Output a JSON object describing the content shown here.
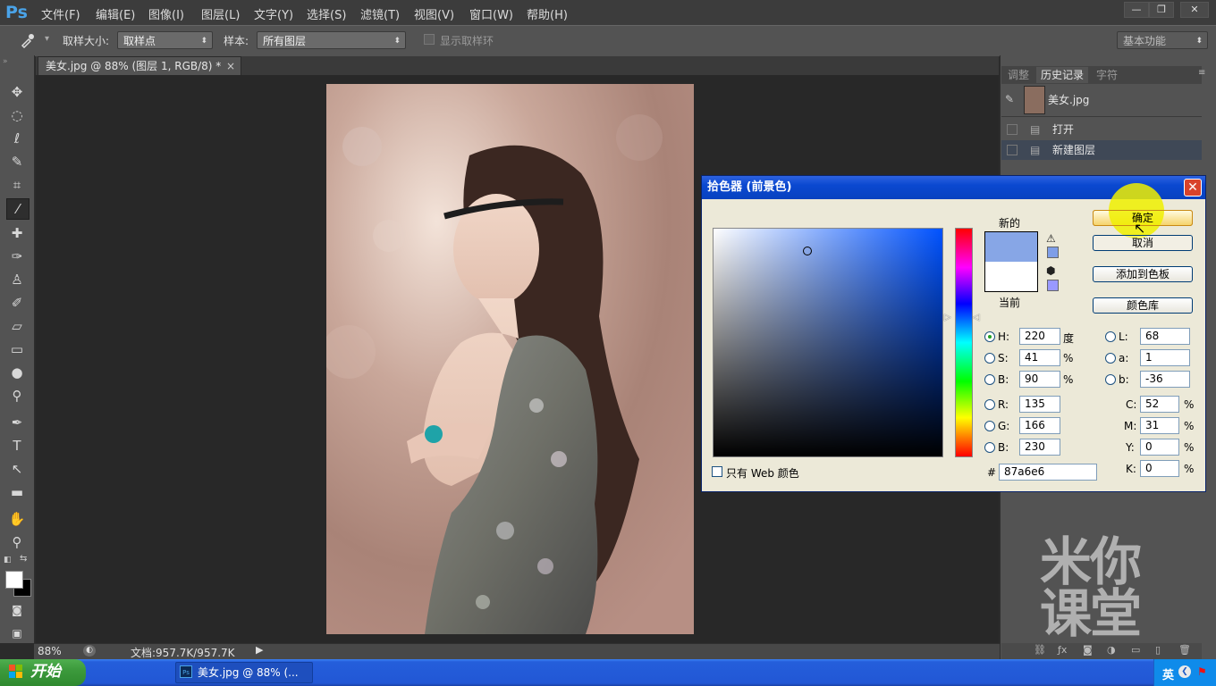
{
  "app": {
    "logo": "Ps"
  },
  "menu": [
    "文件(F)",
    "编辑(E)",
    "图像(I)",
    "图层(L)",
    "文字(Y)",
    "选择(S)",
    "滤镜(T)",
    "视图(V)",
    "窗口(W)",
    "帮助(H)"
  ],
  "window_buttons": {
    "minimize": "—",
    "restore": "❐",
    "close": "✕"
  },
  "options": {
    "sample_size_label": "取样大小:",
    "sample_size_value": "取样点",
    "sample_label": "样本:",
    "sample_value": "所有图层",
    "show_ring_label": "显示取样环",
    "workspace": "基本功能"
  },
  "document": {
    "tab_title": "美女.jpg @ 88% (图层 1, RGB/8) *",
    "tab_close": "×"
  },
  "status": {
    "zoom": "88%",
    "doc_info": "文档:957.7K/957.7K"
  },
  "panel": {
    "tabs": [
      "调整",
      "历史记录",
      "字符"
    ],
    "snapshot_name": "美女.jpg",
    "history": [
      "打开",
      "新建图层"
    ]
  },
  "color_picker": {
    "title": "拾色器 (前景色)",
    "close": "✕",
    "new_label": "新的",
    "current_label": "当前",
    "new_color": "#87a6e6",
    "current_color": "#ffffff",
    "buttons": {
      "ok": "确定",
      "cancel": "取消",
      "add_swatch": "添加到色板",
      "libraries": "颜色库"
    },
    "hsb": {
      "h_label": "H:",
      "h": "220",
      "h_unit": "度",
      "s_label": "S:",
      "s": "41",
      "s_unit": "%",
      "b_label": "B:",
      "b": "90",
      "b_unit": "%"
    },
    "rgb": {
      "r_label": "R:",
      "r": "135",
      "g_label": "G:",
      "g": "166",
      "b_label": "B:",
      "b": "230"
    },
    "lab": {
      "l_label": "L:",
      "l": "68",
      "a_label": "a:",
      "a": "1",
      "b_label": "b:",
      "b": "-36"
    },
    "cmyk": {
      "c_label": "C:",
      "c": "52",
      "m_label": "M:",
      "m": "31",
      "y_label": "Y:",
      "y": "0",
      "k_label": "K:",
      "k": "0",
      "unit": "%"
    },
    "hex_label": "#",
    "hex": "87a6e6",
    "web_only_label": "只有 Web 颜色"
  },
  "watermark": {
    "line1": "米你",
    "line2": "课堂"
  },
  "taskbar": {
    "start": "开始",
    "task_label": "美女.jpg @ 88% (...",
    "ime": "英"
  }
}
